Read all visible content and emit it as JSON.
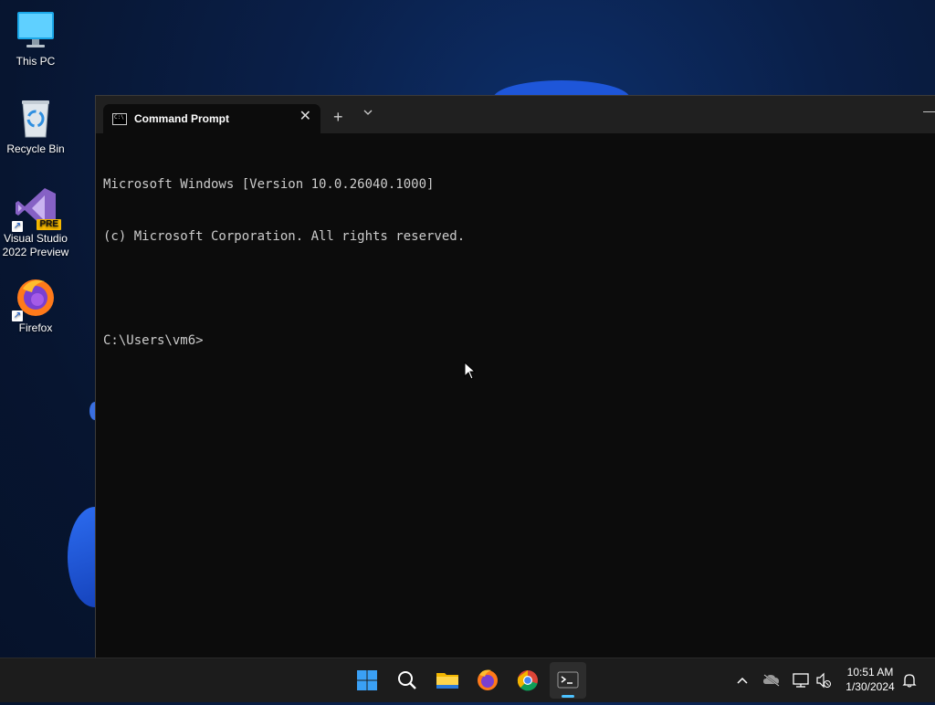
{
  "desktop": {
    "icons": [
      {
        "name": "This PC",
        "icon": "this-pc-icon"
      },
      {
        "name": "Recycle Bin",
        "icon": "recycle-bin-icon"
      },
      {
        "name": "Visual Studio 2022 Preview",
        "line1": "Visual Studio",
        "line2": "2022 Preview",
        "badge": "PRE",
        "icon": "visual-studio-icon"
      },
      {
        "name": "Firefox",
        "icon": "firefox-icon"
      }
    ]
  },
  "terminal": {
    "tab_title": "Command Prompt",
    "new_tab_symbol": "+",
    "close_symbol": "✕",
    "lines": [
      "Microsoft Windows [Version 10.0.26040.1000]",
      "(c) Microsoft Corporation. All rights reserved.",
      "",
      "C:\\Users\\vm6>"
    ]
  },
  "taskbar": {
    "apps": [
      "start-icon",
      "search-icon",
      "file-explorer-icon",
      "firefox-icon",
      "chrome-icon",
      "terminal-icon"
    ],
    "active_app": "terminal-icon",
    "clock": {
      "time": "10:51 AM",
      "date": "1/30/2024"
    },
    "colors": {
      "accent": "#4cc2ff",
      "taskbar_bg": "#1c1c1c"
    }
  }
}
